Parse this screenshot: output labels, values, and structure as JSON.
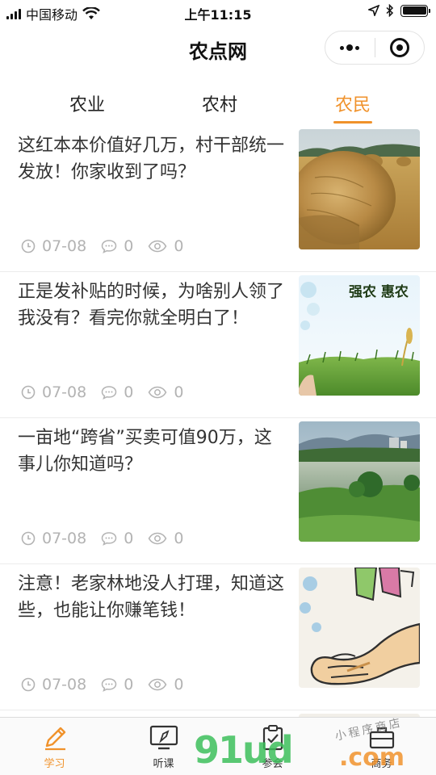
{
  "status_bar": {
    "carrier": "中国移动",
    "time": "上午11:15"
  },
  "nav": {
    "title": "农点网"
  },
  "tabs": [
    {
      "label": "农业",
      "active": false
    },
    {
      "label": "农村",
      "active": false
    },
    {
      "label": "农民",
      "active": true
    }
  ],
  "articles": [
    {
      "title": "这红本本价值好几万，村干部统一发放！你家收到了吗？",
      "date": "07-08",
      "comments": "0",
      "views": "0",
      "image": "hay-bale-field"
    },
    {
      "title": "正是发补贴的时候，为啥别人领了我没有？看完你就全明白了！",
      "date": "07-08",
      "comments": "0",
      "views": "0",
      "image": "wheat-field-banner",
      "image_text": "强农 惠农"
    },
    {
      "title": "一亩地“跨省”买卖可值90万，这事儿你知道吗？",
      "date": "07-08",
      "comments": "0",
      "views": "0",
      "image": "river-landscape"
    },
    {
      "title": "注意！老家林地没人打理，知道这些，也能让你赚笔钱！",
      "date": "07-08",
      "comments": "0",
      "views": "0",
      "image": "cartoon-hand"
    }
  ],
  "tabbar": [
    {
      "label": "学习",
      "icon": "pencil-icon",
      "active": true
    },
    {
      "label": "听课",
      "icon": "monitor-icon",
      "active": false
    },
    {
      "label": "参会",
      "icon": "clipboard-icon",
      "active": false
    },
    {
      "label": "商务",
      "icon": "briefcase-icon",
      "active": false
    }
  ],
  "watermark": {
    "main": "91ud",
    "sub": "小程序商店",
    "suffix": ".com"
  },
  "colors": {
    "accent": "#f0922b",
    "meta": "#b3b3b3"
  }
}
